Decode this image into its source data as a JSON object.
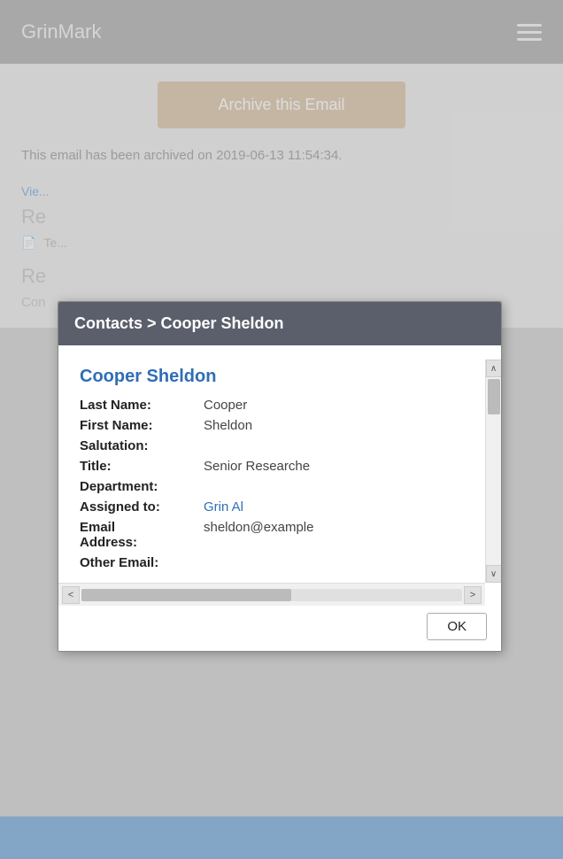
{
  "navbar": {
    "title": "GrinMark",
    "menu_icon_label": "menu"
  },
  "main": {
    "archive_button_label": "Archive this Email",
    "archived_notice": "This email has been archived on 2019-06-13 11:54:34.",
    "view_link_label": "Vie...",
    "re_label_1": "Re",
    "icon_row_text": "Te...",
    "re_label_2": "Re",
    "con_text": "Con"
  },
  "modal": {
    "header": "Contacts > Cooper Sheldon",
    "contact_name": "Cooper Sheldon",
    "fields": [
      {
        "label": "Last Name:",
        "value": "Cooper",
        "type": "text"
      },
      {
        "label": "First Name:",
        "value": "Sheldon",
        "type": "text"
      },
      {
        "label": "Salutation:",
        "value": "",
        "type": "text"
      },
      {
        "label": "Title:",
        "value": "Senior Researche",
        "type": "text"
      },
      {
        "label": "Department:",
        "value": "",
        "type": "text"
      },
      {
        "label": "Assigned to:",
        "value": "Grin Al",
        "type": "link"
      },
      {
        "label": "Email Address:",
        "value": "sheldon@example",
        "type": "text"
      },
      {
        "label": "Other Email:",
        "value": "",
        "type": "text"
      }
    ],
    "ok_button_label": "OK",
    "scroll_up_arrow": "∧",
    "scroll_down_arrow": "∨",
    "hscroll_left_arrow": "<",
    "hscroll_right_arrow": ">"
  }
}
